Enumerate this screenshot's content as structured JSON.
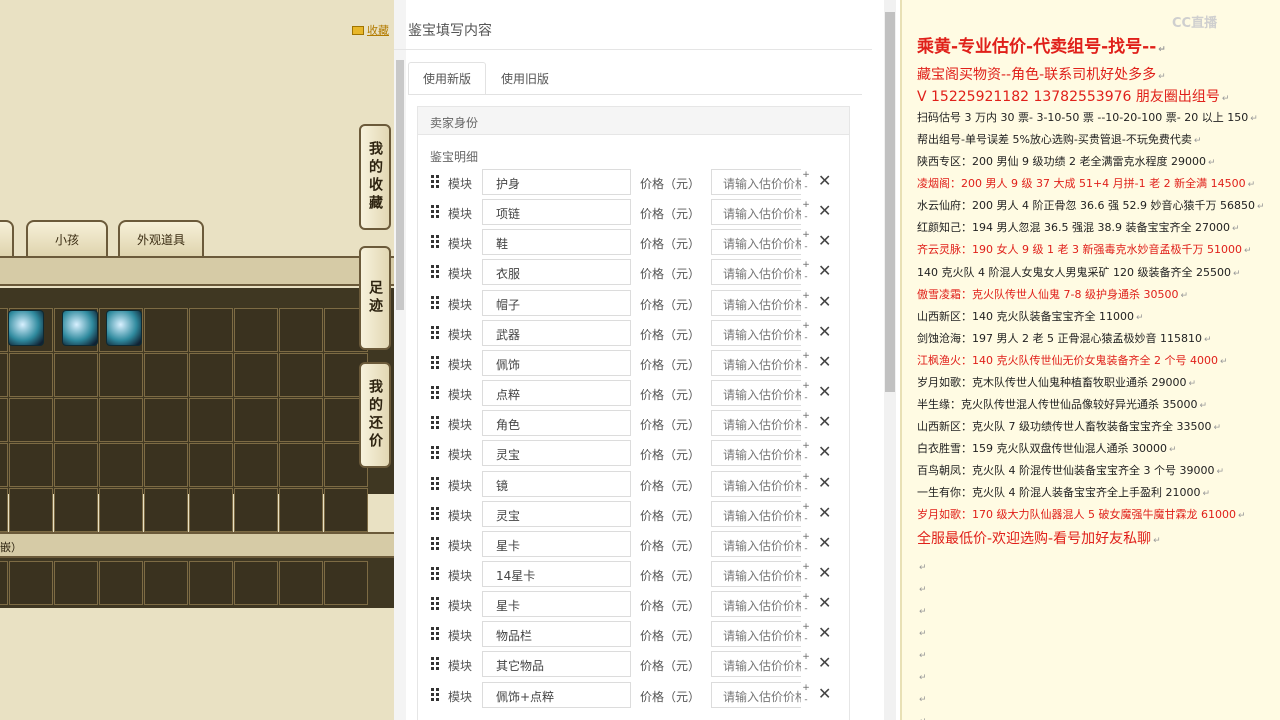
{
  "game": {
    "favorite_link": "收藏",
    "tabs": [
      "小孩",
      "外观道具"
    ],
    "side_tabs": [
      "我的收藏",
      "足迹",
      "我的还价"
    ],
    "gem_label": "嵌）"
  },
  "form": {
    "heading": "鉴宝填写内容",
    "tabs": [
      {
        "label": "使用新版",
        "active": true
      },
      {
        "label": "使用旧版",
        "active": false
      }
    ],
    "seller_section": "卖家身份",
    "detail_section": "鉴宝明细",
    "module_label": "模块",
    "price_label": "价格（元）",
    "price_placeholder": "请输入估价价格",
    "rows": [
      "护身",
      "项链",
      "鞋",
      "衣服",
      "帽子",
      "武器",
      "佩饰",
      "点粹",
      "角色",
      "灵宝",
      "镜",
      "灵宝",
      "星卡",
      "14星卡",
      "星卡",
      "物品栏",
      "其它物品",
      "佩饰+点粹"
    ]
  },
  "notes": {
    "watermark": "CC直播",
    "lines": [
      {
        "text": "乘黄-专业估价-代卖组号-找号--",
        "style": "big"
      },
      {
        "text": "藏宝阁买物资--角色-联系司机好处多多",
        "style": "mid"
      },
      {
        "text": "V 15225921182   13782553976 朋友圈出组号",
        "style": "phone"
      },
      {
        "text": "扫码估号 3 万内 30 票- 3-10-50 票   --10-20-100 票-  20 以上 150",
        "style": "normal"
      },
      {
        "text": "帮出组号-单号误差 5%放心选购-买贵管退-不玩免费代卖",
        "style": "normal"
      },
      {
        "text": "陕西专区：200 男仙 9 级功绩 2 老全满雷克水程度 29000",
        "style": "normal"
      },
      {
        "text": "凌烟阁：200 男人 9 级 37 大成 51+4 月拼-1 老 2 新全满 14500",
        "style": "red"
      },
      {
        "text": "水云仙府：200 男人 4 阶正骨忽 36.6 强 52.9 妙音心猿千万 56850",
        "style": "normal"
      },
      {
        "text": "红颜知己：194 男人忽混 36.5 强混 38.9 装备宝宝齐全 27000",
        "style": "normal"
      },
      {
        "text": "齐云灵脉：190 女人 9 级 1 老 3 新强毒克水妙音孟极千万 51000",
        "style": "red"
      },
      {
        "text": "140 克火队 4 阶混人女鬼女人男鬼采矿 120 级装备齐全 25500",
        "style": "normal"
      },
      {
        "text": "傲雪凌霜：克火队传世人仙鬼 7-8 级护身通杀 30500",
        "style": "red"
      },
      {
        "text": "山西新区：140 克火队装备宝宝齐全 11000",
        "style": "normal"
      },
      {
        "text": "剑蚀沧海：197 男人 2 老 5 正骨混心猿孟极妙音 115810",
        "style": "normal"
      },
      {
        "text": "江枫渔火：140 克火队传世仙无价女鬼装备齐全 2 个号 4000",
        "style": "red"
      },
      {
        "text": "岁月如歌：克木队传世人仙鬼种植畜牧职业通杀 29000",
        "style": "normal"
      },
      {
        "text": "半生缘：克火队传世混人传世仙品像较好异光通杀 35000",
        "style": "normal"
      },
      {
        "text": "山西新区：克火队 7 级功绩传世人畜牧装备宝宝齐全 33500",
        "style": "normal"
      },
      {
        "text": "白衣胜雪：159 克火队双盘传世仙混人通杀 30000",
        "style": "normal"
      },
      {
        "text": "百鸟朝凤：克火队 4 阶混传世仙装备宝宝齐全 3 个号 39000",
        "style": "normal"
      },
      {
        "text": "一生有你：克火队 4 阶混人装备宝宝齐全上手盈利 21000",
        "style": "normal"
      },
      {
        "text": "岁月如歌：170 级大力队仙器混人 5 破女魔强牛魔甘霖龙 61000",
        "style": "red"
      },
      {
        "text": "全服最低价-欢迎选购-看号加好友私聊",
        "style": "mid"
      }
    ]
  }
}
